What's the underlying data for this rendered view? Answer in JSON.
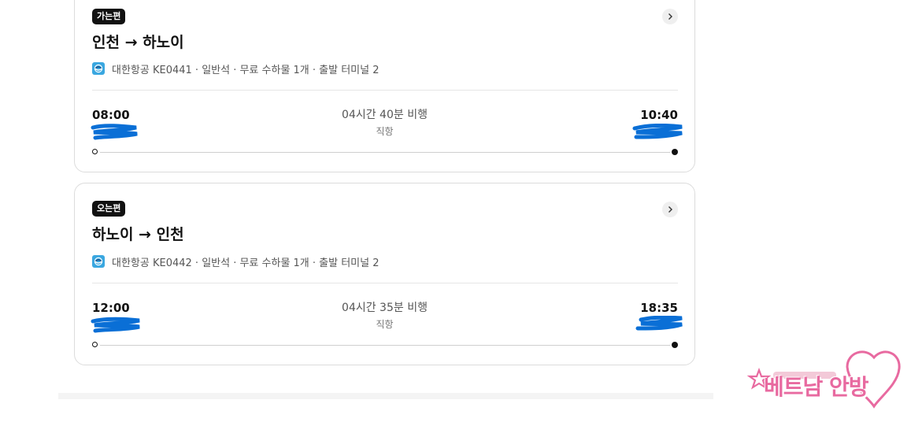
{
  "flights": [
    {
      "badge": "가는편",
      "route": "인천 → 하노이",
      "airline_info": "대한항공 KE0441 · 일반석 · 무료 수하물 1개 · 출발 터미널 2",
      "departure_time": "08:00",
      "arrival_time": "10:40",
      "duration": "04시간 40분 비행",
      "stops": "직항"
    },
    {
      "badge": "오는편",
      "route": "하노이 → 인천",
      "airline_info": "대한항공 KE0442 · 일반석 · 무료 수하물 1개 · 출발 터미널 2",
      "departure_time": "12:00",
      "arrival_time": "18:35",
      "duration": "04시간 35분 비행",
      "stops": "직항"
    }
  ],
  "watermark": {
    "text": "베트남 안방"
  },
  "colors": {
    "redaction": "#0a6fd6",
    "airline_logo": "#3aa7e0",
    "watermark": "#e86aa0"
  },
  "icons": {
    "detail": "chevron-right-icon",
    "airline": "korean-air-logo-icon"
  }
}
